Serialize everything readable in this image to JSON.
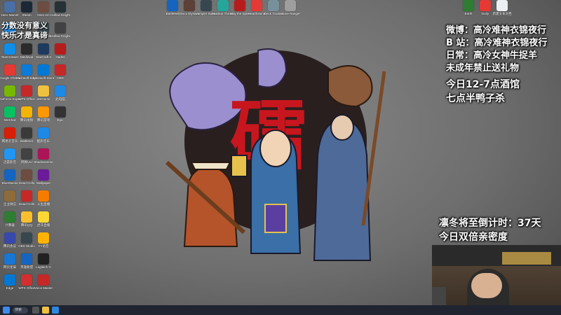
{
  "overlay": {
    "top_left_line1": "分数没有意义",
    "top_left_line2": "快乐才是真谛",
    "right_lines": [
      "微博：高冷难神衣锦夜行",
      "B 站：高冷难神衣锦夜行",
      "日常：高冷女神牛捉羊",
      "未成年禁止送礼物",
      "今日12-7点酒馆",
      "七点半鸭子杀"
    ],
    "countdown_line": "凛冬将至倒计时：37天",
    "bonus_line": "今日双倍亲密度"
  },
  "wallpaper": {
    "glyph": "礌"
  },
  "colors": {
    "accent_red": "#c8161e",
    "taskbar": "#1f2430"
  },
  "desktop_icons": {
    "col1": [
      {
        "label": "Hero Marvel",
        "icon": "game-icon",
        "color": "#4a6fa5"
      },
      {
        "label": "XTBox",
        "icon": "app-icon",
        "color": "#1e88e5"
      },
      {
        "label": "TeamViewer",
        "icon": "teamviewer-icon",
        "color": "#0e8ee9"
      },
      {
        "label": "Google Chrome",
        "icon": "chrome-icon",
        "color": "#e53935"
      },
      {
        "label": "GeForce Experience",
        "icon": "nvidia-icon",
        "color": "#76b900"
      },
      {
        "label": "WeChat",
        "icon": "wechat-icon",
        "color": "#07c160"
      },
      {
        "label": "网易云音乐",
        "icon": "netease-icon",
        "color": "#d81e06"
      },
      {
        "label": "迅雷影音",
        "icon": "app-icon",
        "color": "#2196f3"
      },
      {
        "label": "BlueStacks",
        "icon": "app-icon",
        "color": "#1565c0"
      },
      {
        "label": "企业微信",
        "icon": "app-icon",
        "color": "#8e6b3a"
      },
      {
        "label": "计算器",
        "icon": "app-icon",
        "color": "#2e7d32"
      },
      {
        "label": "腾讯会议",
        "icon": "app-icon",
        "color": "#3949ab"
      },
      {
        "label": "网页星辰",
        "icon": "app-icon",
        "color": "#1976d2"
      },
      {
        "label": "Edge",
        "icon": "edge-icon",
        "color": "#0078d4"
      }
    ],
    "col2": [
      {
        "label": "Steam",
        "icon": "steam-icon",
        "color": "#1b2838"
      },
      {
        "label": "Firefox",
        "icon": "app-icon",
        "color": "#555"
      },
      {
        "label": "Medieval",
        "icon": "app-icon",
        "color": "#2b2b2b"
      },
      {
        "label": "Microsoft Edge",
        "icon": "edge-icon",
        "color": "#0c7ad7"
      },
      {
        "label": "WPS Office",
        "icon": "wps-icon",
        "color": "#c62828"
      },
      {
        "label": "腾讯视频",
        "icon": "app-icon",
        "color": "#f4b400"
      },
      {
        "label": "Battlenet",
        "icon": "app-icon",
        "color": "#3a3a3a"
      },
      {
        "label": "网易UU",
        "icon": "app-icon",
        "color": "#424242"
      },
      {
        "label": "Dead Cells",
        "icon": "app-icon",
        "color": "#6d4c41"
      },
      {
        "label": "Dead Cells",
        "icon": "app-icon",
        "color": "#c62828"
      },
      {
        "label": "腾讯QQ",
        "icon": "app-icon",
        "color": "#fbc02d"
      },
      {
        "label": "OBS Studio",
        "icon": "app-icon",
        "color": "#37474f"
      },
      {
        "label": "英雄联盟",
        "icon": "app-icon",
        "color": "#1565c0"
      },
      {
        "label": "WPS Office",
        "icon": "wps-icon",
        "color": "#d32f2f"
      }
    ],
    "col3": [
      {
        "label": "Hero Arc",
        "icon": "app-icon",
        "color": "#6d4c41"
      },
      {
        "label": "Dead Cells",
        "icon": "app-icon",
        "color": "#37474f"
      },
      {
        "label": "StarCraft II",
        "icon": "app-icon",
        "color": "#1e3a5f"
      },
      {
        "label": "Microsoft Store",
        "icon": "store-icon",
        "color": "#0078d4"
      },
      {
        "label": "WeGame",
        "icon": "folder-icon",
        "color": "#f0c040"
      },
      {
        "label": "腾讯游戏",
        "icon": "app-icon",
        "color": "#ff9800"
      },
      {
        "label": "酷狗音乐",
        "icon": "music-icon",
        "color": "#1e88e5"
      },
      {
        "label": "Shadowverse",
        "icon": "app-icon",
        "color": "#ad1457"
      },
      {
        "label": "Wallpaper",
        "icon": "app-icon",
        "color": "#6a1b9a"
      },
      {
        "label": "斗鱼直播",
        "icon": "app-icon",
        "color": "#f57c00"
      },
      {
        "label": "虎牙直播",
        "icon": "app-icon",
        "color": "#fdd835"
      },
      {
        "label": "YY语音",
        "icon": "app-icon",
        "color": "#ffb300"
      },
      {
        "label": "Logitech G",
        "icon": "app-icon",
        "color": "#212121"
      },
      {
        "label": "Voice Master",
        "icon": "app-icon",
        "color": "#c62828"
      }
    ],
    "col4": [
      {
        "label": "Hollow Knight",
        "icon": "app-icon",
        "color": "#263238"
      },
      {
        "label": "Hollow Knight",
        "icon": "app-icon",
        "color": "#424242"
      },
      {
        "label": "Hades",
        "icon": "app-icon",
        "color": "#b71c1c"
      },
      {
        "label": "OBS",
        "icon": "app-icon",
        "color": "#c62828"
      },
      {
        "label": "此电脑",
        "icon": "pc-icon",
        "color": "#1e88e5"
      },
      {
        "label": "Epic",
        "icon": "app-icon",
        "color": "#333"
      }
    ],
    "top_row": [
      {
        "label": "BattleNet",
        "icon": "app-icon",
        "color": "#1565c0"
      },
      {
        "label": "Disco Elysium",
        "icon": "app-icon",
        "color": "#5d4037"
      },
      {
        "label": "Vampire Survivors",
        "icon": "app-icon",
        "color": "#37474f"
      },
      {
        "label": "Nuclear Throne",
        "icon": "app-icon",
        "color": "#26a69a"
      },
      {
        "label": "Slay the Spire",
        "icon": "app-icon",
        "color": "#b71c1c"
      },
      {
        "label": "Hearthstone",
        "icon": "app-icon",
        "color": "#e53935"
      },
      {
        "label": "Deck Tracker",
        "icon": "app-icon",
        "color": "#78909c"
      },
      {
        "label": "Stone Ranger",
        "icon": "app-icon",
        "color": "#9e9e9e"
      }
    ],
    "top_right": [
      {
        "label": "Earth",
        "icon": "globe-icon",
        "color": "#2e7d32"
      },
      {
        "label": "Daily",
        "icon": "app-icon",
        "color": "#e53935"
      },
      {
        "label": "新建文本文档",
        "icon": "file-icon",
        "color": "#eceff1"
      }
    ]
  },
  "taskbar": {
    "search_label": "搜索"
  }
}
